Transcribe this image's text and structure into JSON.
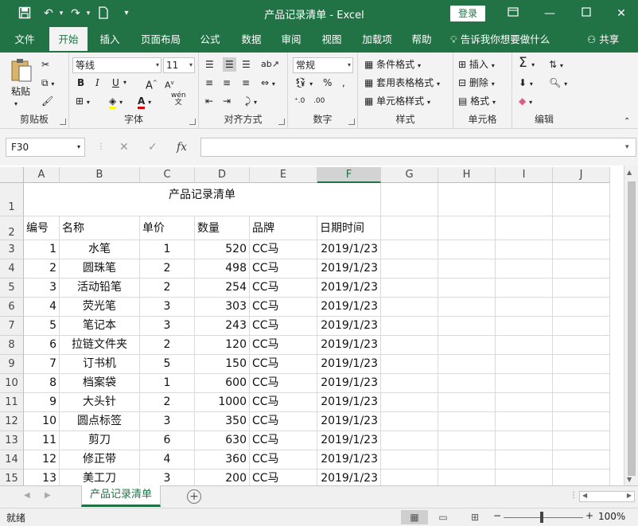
{
  "window": {
    "title": "产品记录清单  -  Excel",
    "login_label": "登录",
    "qat": [
      "save-icon",
      "undo-icon",
      "redo-icon",
      "new-file-icon",
      "customize-icon"
    ]
  },
  "tabs": [
    "文件",
    "开始",
    "插入",
    "页面布局",
    "公式",
    "数据",
    "审阅",
    "视图",
    "加载项",
    "帮助"
  ],
  "active_tab": "开始",
  "tell_me": "告诉我你想要做什么",
  "share": "共享",
  "ribbon": {
    "clipboard": {
      "label": "剪贴板",
      "paste": "粘贴"
    },
    "font": {
      "label": "字体",
      "name": "等线",
      "size": "11",
      "bold": "B",
      "italic": "I",
      "underline": "U",
      "wen": "wén\n文"
    },
    "alignment": {
      "label": "对齐方式"
    },
    "number": {
      "label": "数字",
      "format": "常规"
    },
    "styles": {
      "label": "样式",
      "cond": "条件格式",
      "table": "套用表格格式",
      "cell": "单元格样式"
    },
    "cells": {
      "label": "单元格",
      "insert": "插入",
      "delete": "删除",
      "format": "格式"
    },
    "editing": {
      "label": "编辑"
    }
  },
  "formula_bar": {
    "name_box": "F30",
    "cancel": "✕",
    "enter": "✓",
    "fx": "fx",
    "content": ""
  },
  "columns": [
    "A",
    "B",
    "C",
    "D",
    "E",
    "F",
    "G",
    "H",
    "I",
    "J"
  ],
  "selected_column": "F",
  "sheet": {
    "title": "产品记录清单",
    "headers": [
      "编号",
      "名称",
      "单价",
      "数量",
      "品牌",
      "日期时间"
    ],
    "rows": [
      [
        "1",
        "水笔",
        "1",
        "520",
        "CC马",
        "2019/1/23"
      ],
      [
        "2",
        "圆珠笔",
        "2",
        "498",
        "CC马",
        "2019/1/23"
      ],
      [
        "3",
        "活动铅笔",
        "2",
        "254",
        "CC马",
        "2019/1/23"
      ],
      [
        "4",
        "荧光笔",
        "3",
        "303",
        "CC马",
        "2019/1/23"
      ],
      [
        "5",
        "笔记本",
        "3",
        "243",
        "CC马",
        "2019/1/23"
      ],
      [
        "6",
        "拉链文件夹",
        "2",
        "120",
        "CC马",
        "2019/1/23"
      ],
      [
        "7",
        "订书机",
        "5",
        "150",
        "CC马",
        "2019/1/23"
      ],
      [
        "8",
        "档案袋",
        "1",
        "600",
        "CC马",
        "2019/1/23"
      ],
      [
        "9",
        "大头针",
        "2",
        "1000",
        "CC马",
        "2019/1/23"
      ],
      [
        "10",
        "圆点标签",
        "3",
        "350",
        "CC马",
        "2019/1/23"
      ],
      [
        "11",
        "剪刀",
        "6",
        "630",
        "CC马",
        "2019/1/23"
      ],
      [
        "12",
        "修正带",
        "4",
        "360",
        "CC马",
        "2019/1/23"
      ],
      [
        "13",
        "美工刀",
        "3",
        "200",
        "CC马",
        "2019/1/23"
      ]
    ]
  },
  "row_numbers": [
    "1",
    "2",
    "3",
    "4",
    "5",
    "6",
    "7",
    "8",
    "9",
    "10",
    "11",
    "12",
    "13",
    "14",
    "15"
  ],
  "sheet_tab": "产品记录清单",
  "status": {
    "ready": "就绪",
    "zoom": "100%"
  }
}
